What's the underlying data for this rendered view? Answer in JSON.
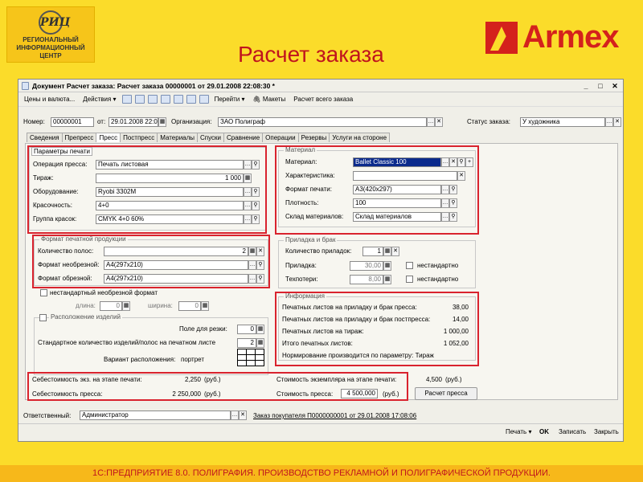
{
  "logo": {
    "circle": "РИЦ",
    "l1": "РЕГИОНАЛЬНЫЙ",
    "l2": "ИНФОРМАЦИОННЫЙ",
    "l3": "ЦЕНТР"
  },
  "slide_title": "Расчет заказа",
  "brand": "Armex",
  "footer": "1С:ПРЕДПРИЯТИЕ 8.0. ПОЛИГРАФИЯ. ПРОИЗВОДСТВО РЕКЛАМНОЙ И ПОЛИГРАФИЧЕСКОЙ ПРОДУКЦИИ.",
  "window": {
    "title": "Документ Расчет заказа: Расчет заказа 00000001 от 29.01.2008 22:08:30 *"
  },
  "toolbar": {
    "prices": "Цены и валюта...",
    "actions": "Действия",
    "goto": "Перейти",
    "layouts": "Макеты",
    "calc_all": "Расчет всего заказа"
  },
  "header": {
    "number_label": "Номер:",
    "number": "00000001",
    "from_label": "от:",
    "date": "29.01.2008 22:0",
    "org_label": "Организация:",
    "org": "ЗАО Полиграф",
    "status_label": "Статус заказа:",
    "status": "У художника"
  },
  "tabs": [
    "Сведения",
    "Препресс",
    "Пресс",
    "Постпресс",
    "Материалы",
    "Спуски",
    "Сравнение",
    "Операции",
    "Резервы",
    "Услуги на стороне"
  ],
  "print_params": {
    "title": "Параметры печати",
    "op_label": "Операция пресса:",
    "op": "Печать листовая",
    "run_label": "Тираж:",
    "run": "1 000",
    "eq_label": "Оборудование:",
    "eq": "Ryobi 3302M",
    "col_label": "Красочность:",
    "col": "4+0",
    "grp_label": "Группа красок:",
    "grp": "CMYK 4+0 60%"
  },
  "format": {
    "title": "Формат печатной продукции",
    "pages_label": "Количество полос:",
    "pages": "2",
    "untrim_label": "Формат необрезной:",
    "untrim": "А4(297x210)",
    "trim_label": "Формат обрезной:",
    "trim": "А4(297x210)",
    "nonstd": "нестандартный необрезной формат",
    "len_label": "длина:",
    "len": "0",
    "wid_label": "ширина:",
    "wid": "0"
  },
  "layout": {
    "title": "Расположение изделий",
    "margin_label": "Поле для резки:",
    "margin": "0",
    "std_label": "Стандартное количество изделий/полос на печатном листе",
    "std": "2",
    "variant_label": "Вариант расположения:",
    "variant": "портрет"
  },
  "material": {
    "title": "Материал",
    "mat_label": "Материал:",
    "mat": "Ballet Classic 100",
    "char_label": "Характеристика:",
    "fmt_label": "Формат печати:",
    "fmt": "А3(420x297)",
    "dens_label": "Плотность:",
    "dens": "100",
    "wh_label": "Склад материалов:",
    "wh": "Склад материалов"
  },
  "makeready": {
    "title": "Приладка и брак",
    "count_label": "Количество приладок:",
    "count": "1",
    "mr_label": "Приладка:",
    "mr": "30,00",
    "tl_label": "Техпотери:",
    "tl": "8,00",
    "nonstd": "нестандартно"
  },
  "info": {
    "title": "Информация",
    "r1": "Печатных листов на приладку и брак пресса:",
    "v1": "38,00",
    "r2": "Печатных листов на приладку и брак постпресса:",
    "v2": "14,00",
    "r3": "Печатных листов на тираж:",
    "v3": "1 000,00",
    "r4": "Итого печатных листов:",
    "v4": "1 052,00",
    "r5": "Нормирование производится по параметру: Тираж"
  },
  "cost": {
    "unit_label": "Себестоимость экз. на этапе печати:",
    "unit": "2,250",
    "rub": "(руб.)",
    "press_label": "Себестоимость пресса:",
    "press": "2 250,000",
    "unit_price_label": "Стоимость экземпляра на этапе печати:",
    "unit_price": "4,500",
    "price_label": "Стоимость пресса:",
    "price": "4 500,000",
    "calc_btn": "Расчет пресса"
  },
  "footer_form": {
    "resp_label": "Ответственный:",
    "resp": "Администратор",
    "link": "Заказ покупателя П0000000001 от 29.01.2008 17:08:06"
  },
  "actions": {
    "print": "Печать",
    "ok": "OK",
    "save": "Записать",
    "close": "Закрыть"
  }
}
